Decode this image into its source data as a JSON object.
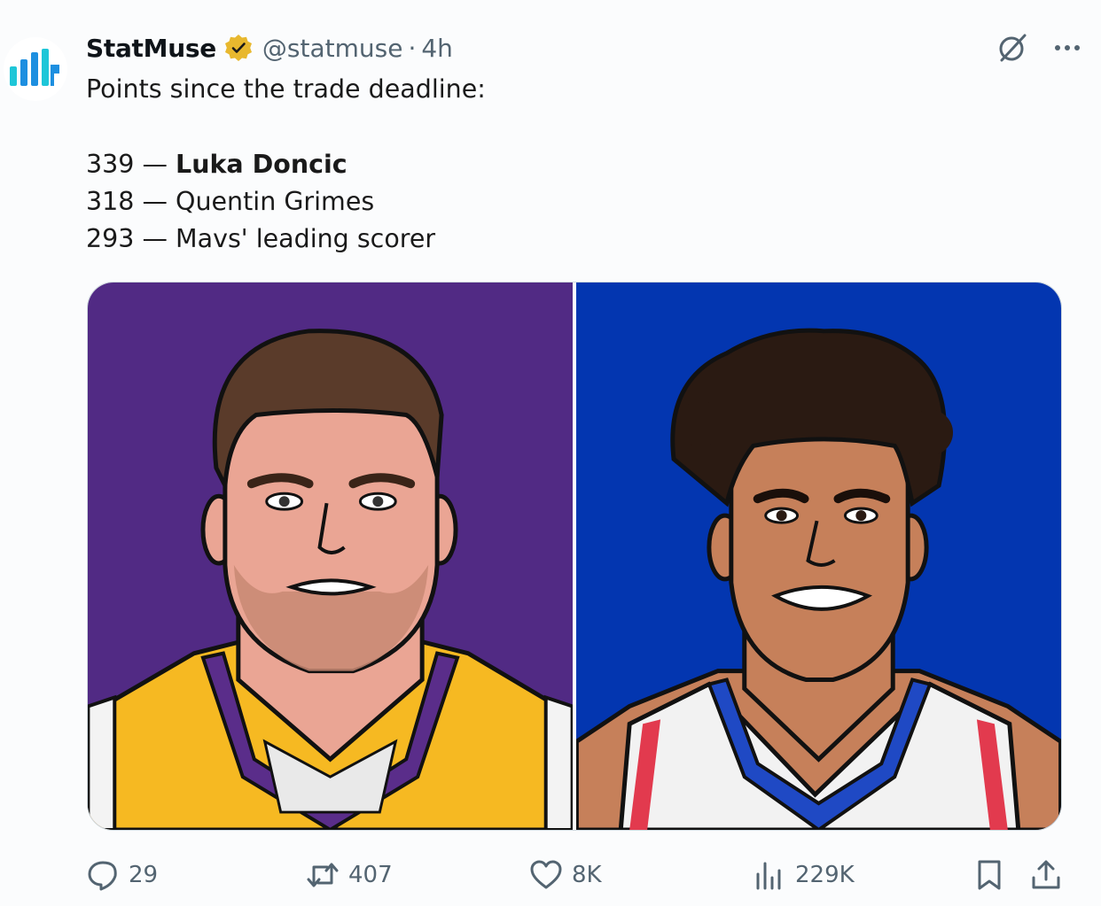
{
  "tweet": {
    "author_name": "StatMuse",
    "handle": "@statmuse",
    "separator": "·",
    "time": "4h",
    "text_intro": "Points since the trade deadline:",
    "lines": [
      {
        "points": "339",
        "dash": " — ",
        "player": "Luka Doncic"
      },
      {
        "points": "318",
        "dash": " — ",
        "player": "Quentin Grimes"
      },
      {
        "points": "293",
        "dash": " — ",
        "player": "Mavs' leading scorer"
      }
    ]
  },
  "media": {
    "left_bg": "#512a84",
    "right_bg": "#0336b0"
  },
  "actions": {
    "replies": "29",
    "retweets": "407",
    "likes": "8K",
    "views": "229K"
  },
  "icons": {
    "verified": "verified-badge-icon",
    "grok": "grok-icon",
    "more": "more-icon",
    "reply": "reply-icon",
    "retweet": "retweet-icon",
    "like": "heart-icon",
    "views": "views-icon",
    "bookmark": "bookmark-icon",
    "share": "share-icon"
  },
  "colors": {
    "verified_gold": "#e8b82e",
    "muted_text": "#536471",
    "logo_blue": "#1d8fe0"
  }
}
